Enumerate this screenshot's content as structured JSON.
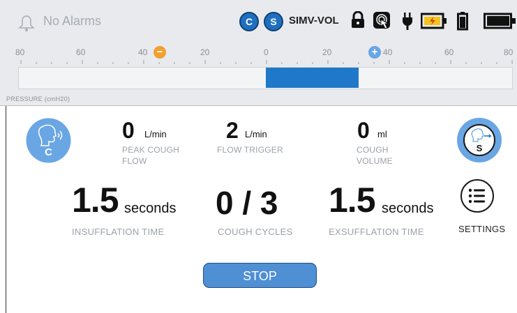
{
  "status_bar": {
    "alarm_text": "No Alarms",
    "badge_c": "C",
    "badge_s": "S",
    "mode": "SIMV-VOL",
    "icons": [
      "bell-icon",
      "lock-icon",
      "touch-lock-icon",
      "plug-icon",
      "battery-charging-icon",
      "battery-small-icon",
      "battery-full-icon"
    ]
  },
  "pressure_scale": {
    "tick_labels": [
      "80",
      "60",
      "40",
      "20",
      "0",
      "20",
      "40",
      "60",
      "80"
    ],
    "label": "PRESSURE (cmH20)",
    "minus_marker": "−",
    "plus_marker": "+"
  },
  "metrics": {
    "peak_cough_flow": {
      "value": "0",
      "unit": "L/min",
      "caption_1": "PEAK COUGH",
      "caption_2": "FLOW"
    },
    "flow_trigger": {
      "value": "2",
      "unit": "L/min",
      "caption": "FLOW TRIGGER"
    },
    "cough_volume": {
      "value": "0",
      "unit": "ml",
      "caption_1": "COUGH",
      "caption_2": "VOLUME"
    },
    "insufflation_time": {
      "value": "1.5",
      "unit": "seconds",
      "caption": "INSUFFLATION TIME"
    },
    "cough_cycles": {
      "value": "0 / 3",
      "caption": "COUGH CYCLES"
    },
    "exsufflation_time": {
      "value": "1.5",
      "unit": "seconds",
      "caption": "EXSUFFLATION TIME"
    }
  },
  "mode_icons": {
    "left_letter": "C",
    "right_letter": "S"
  },
  "settings": {
    "label": "SETTINGS"
  },
  "stop_button": {
    "label": "STOP"
  },
  "colors": {
    "accent": "#1f78c8",
    "stop": "#4f8fd4",
    "badge": "#1f6fc0",
    "minus_marker": "#f0a030",
    "plus_marker": "#6aa6e4",
    "mode_icon": "#6aa6e4"
  }
}
